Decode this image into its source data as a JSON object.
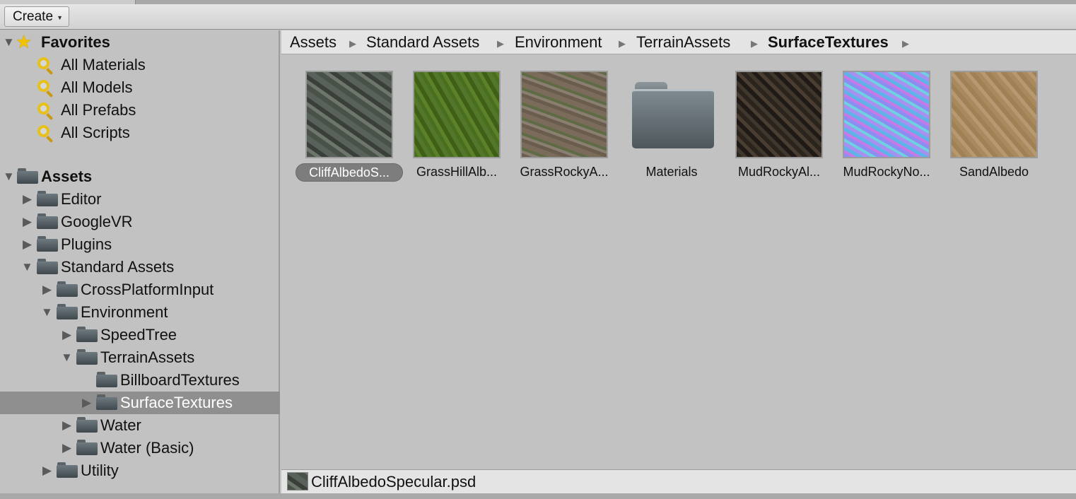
{
  "toolbar": {
    "create_label": "Create"
  },
  "tree": {
    "favorites": {
      "label": "Favorites",
      "items": [
        "All Materials",
        "All Models",
        "All Prefabs",
        "All Scripts"
      ]
    },
    "assets": {
      "label": "Assets",
      "items": [
        "Editor",
        "GoogleVR",
        "Plugins",
        "Standard Assets",
        "CrossPlatformInput",
        "Environment",
        "SpeedTree",
        "TerrainAssets",
        "BillboardTextures",
        "SurfaceTextures",
        "Water",
        "Water (Basic)",
        "Utility"
      ],
      "selected": "SurfaceTextures"
    }
  },
  "breadcrumb": [
    "Assets",
    "Standard Assets",
    "Environment",
    "TerrainAssets",
    "SurfaceTextures"
  ],
  "grid": {
    "items": [
      {
        "name": "CliffAlbedoS...",
        "texture": "cliff"
      },
      {
        "name": "GrassHillAlb...",
        "texture": "grass"
      },
      {
        "name": "GrassRockyA...",
        "texture": "rocky"
      },
      {
        "name": "Materials",
        "texture": "folder"
      },
      {
        "name": "MudRockyAl...",
        "texture": "mud"
      },
      {
        "name": "MudRockyNo...",
        "texture": "normal"
      },
      {
        "name": "SandAlbedo",
        "texture": "sand"
      }
    ],
    "selected": "CliffAlbedoS..."
  },
  "status": {
    "filename": "CliffAlbedoSpecular.psd"
  },
  "colors": {
    "selection": "#8f8f8f",
    "panel": "#c2c2c2",
    "favorite_star": "#f2c200",
    "search_icon": "#e7c019"
  }
}
